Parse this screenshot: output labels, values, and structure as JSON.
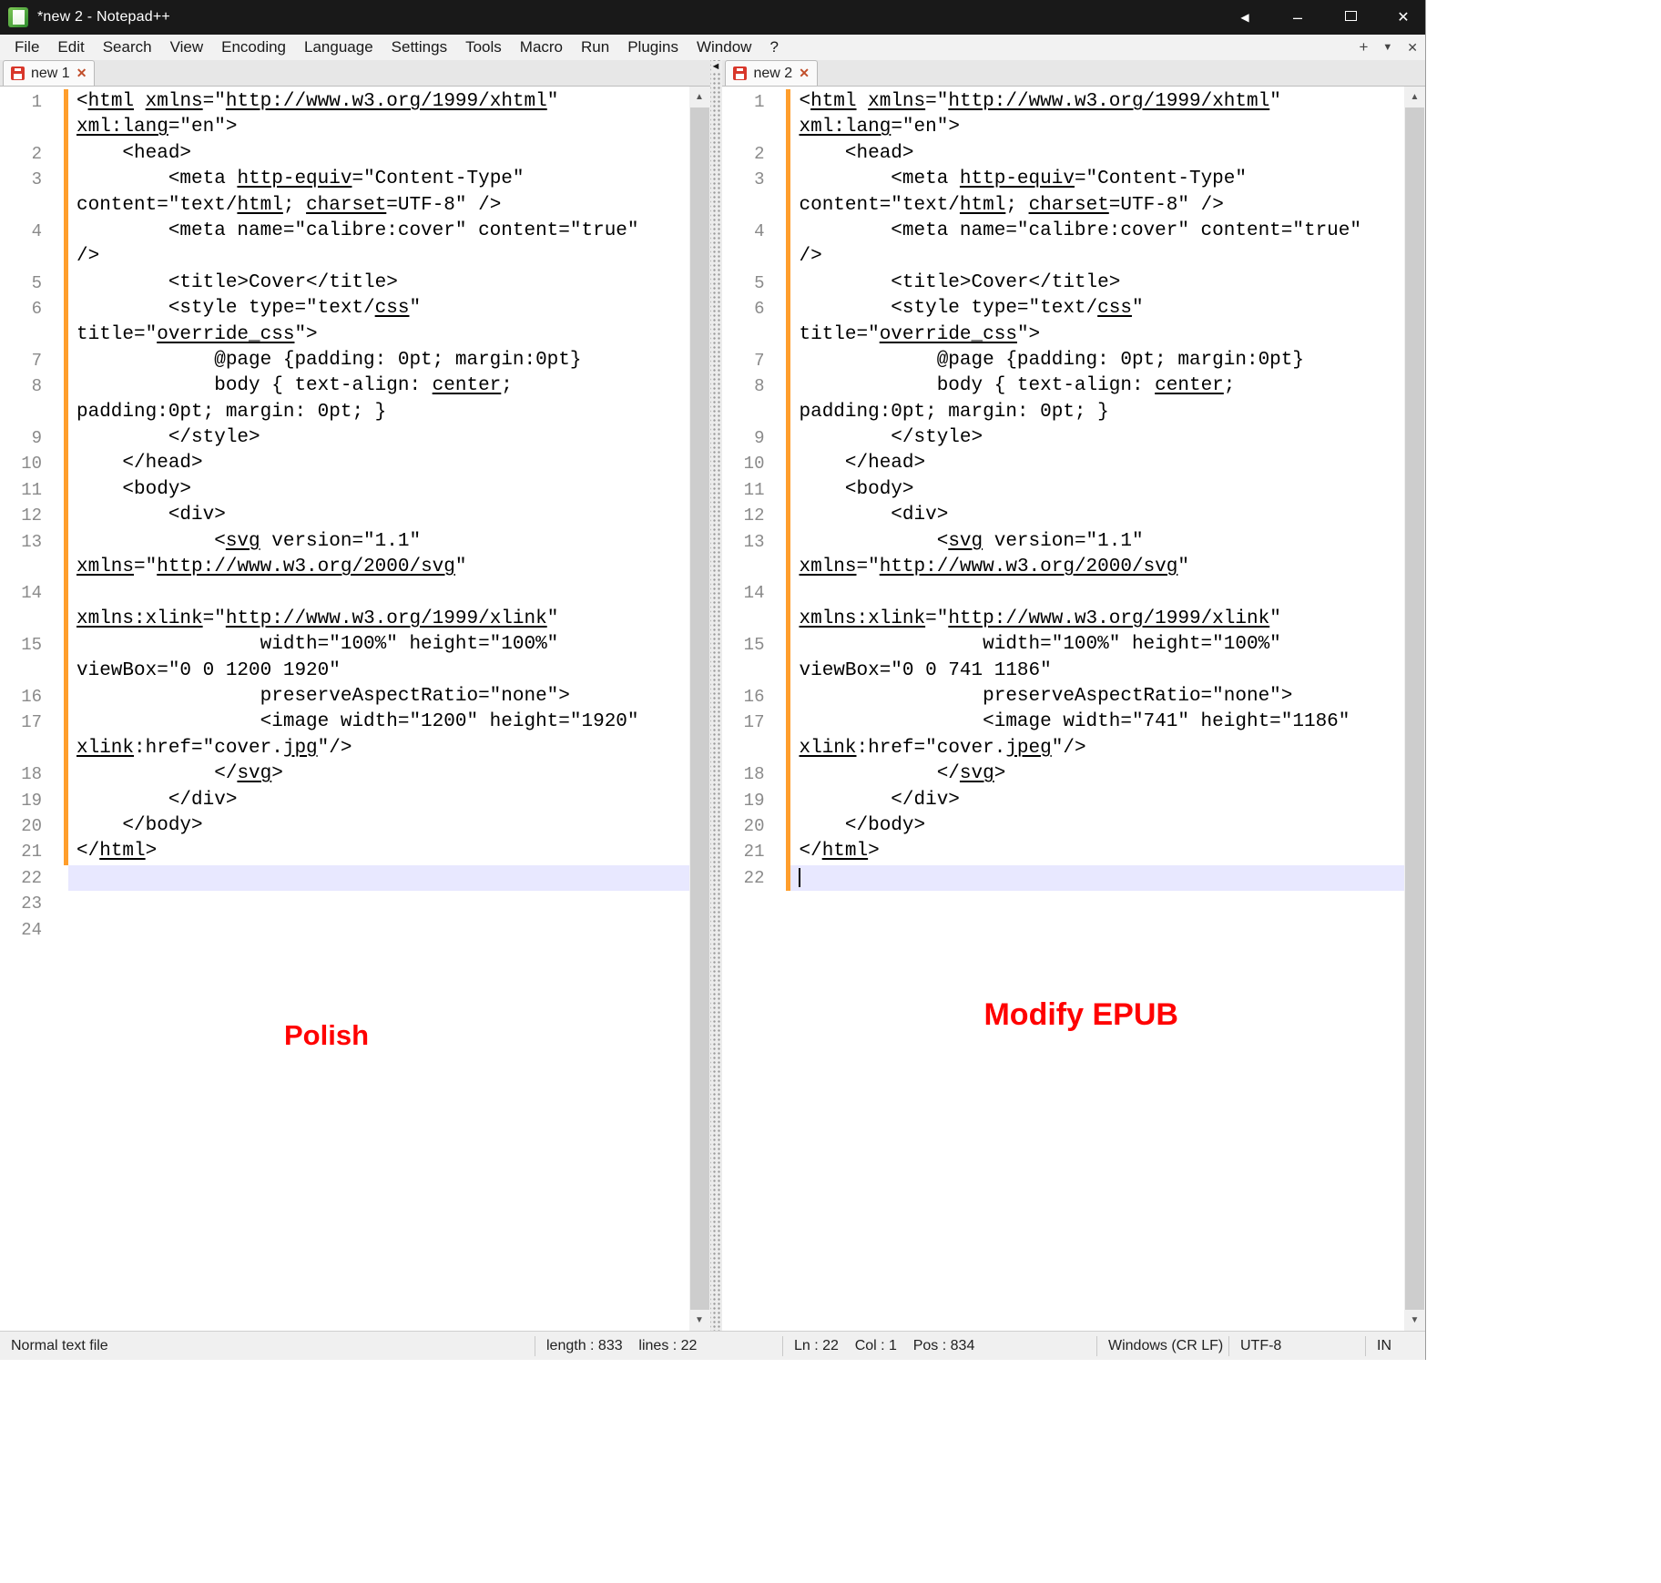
{
  "window": {
    "title": "*new 2 - Notepad++"
  },
  "menu": {
    "items": [
      "File",
      "Edit",
      "Search",
      "View",
      "Encoding",
      "Language",
      "Settings",
      "Tools",
      "Macro",
      "Run",
      "Plugins",
      "Window",
      "?"
    ]
  },
  "panes": [
    {
      "tab_label": "new 1",
      "annotation": "Polish",
      "highlight_row": 30,
      "caret_row": -1,
      "modified_last_row": 29,
      "rows": [
        {
          "n": "1",
          "t": "<⟦html⟧ ⟦xmlns⟧=\"⟦http://www.w3.org/1999/xhtml⟧\""
        },
        {
          "n": "",
          "t": "⟦xml:lang⟧=\"en\">"
        },
        {
          "n": "2",
          "t": "    <head>"
        },
        {
          "n": "3",
          "t": "        <meta ⟦http-equiv⟧=\"Content-Type\""
        },
        {
          "n": "",
          "t": "content=\"text/⟦html⟧; ⟦charset⟧=UTF-8\" />"
        },
        {
          "n": "4",
          "t": "        <meta name=\"calibre:cover\" content=\"true\""
        },
        {
          "n": "",
          "t": "/>"
        },
        {
          "n": "5",
          "t": "        <title>Cover</title>"
        },
        {
          "n": "6",
          "t": "        <style type=\"text/⟦css⟧\""
        },
        {
          "n": "",
          "t": "title=\"⟦override_css⟧\">"
        },
        {
          "n": "7",
          "t": "            @page {padding: 0pt; margin:0pt}"
        },
        {
          "n": "8",
          "t": "            body { text-align: ⟦center⟧;"
        },
        {
          "n": "",
          "t": "padding:0pt; margin: 0pt; }"
        },
        {
          "n": "9",
          "t": "        </style>"
        },
        {
          "n": "10",
          "t": "    </head>"
        },
        {
          "n": "11",
          "t": "    <body>"
        },
        {
          "n": "12",
          "t": "        <div>"
        },
        {
          "n": "13",
          "t": "            <⟦svg⟧ version=\"1.1\""
        },
        {
          "n": "",
          "t": "⟦xmlns⟧=\"⟦http://www.w3.org/2000/svg⟧\""
        },
        {
          "n": "14",
          "t": ""
        },
        {
          "n": "",
          "t": "⟦xmlns:xlink⟧=\"⟦http://www.w3.org/1999/xlink⟧\""
        },
        {
          "n": "15",
          "t": "                width=\"100%\" height=\"100%\""
        },
        {
          "n": "",
          "t": "viewBox=\"0 0 1200 1920\""
        },
        {
          "n": "16",
          "t": "                preserveAspectRatio=\"none\">"
        },
        {
          "n": "17",
          "t": "                <image width=\"1200\" height=\"1920\""
        },
        {
          "n": "",
          "t": "⟦xlink⟧:href=\"cover.⟦jpg⟧\"/>"
        },
        {
          "n": "18",
          "t": "            </⟦svg⟧>"
        },
        {
          "n": "19",
          "t": "        </div>"
        },
        {
          "n": "20",
          "t": "    </body>"
        },
        {
          "n": "21",
          "t": "</⟦html⟧>"
        },
        {
          "n": "22",
          "t": ""
        },
        {
          "n": "23",
          "t": ""
        },
        {
          "n": "24",
          "t": ""
        }
      ]
    },
    {
      "tab_label": "new 2",
      "annotation": "Modify EPUB",
      "highlight_row": 30,
      "caret_row": 30,
      "modified_last_row": 30,
      "rows": [
        {
          "n": "1",
          "t": "<⟦html⟧ ⟦xmlns⟧=\"⟦http://www.w3.org/1999/xhtml⟧\""
        },
        {
          "n": "",
          "t": "⟦xml:lang⟧=\"en\">"
        },
        {
          "n": "2",
          "t": "    <head>"
        },
        {
          "n": "3",
          "t": "        <meta ⟦http-equiv⟧=\"Content-Type\""
        },
        {
          "n": "",
          "t": "content=\"text/⟦html⟧; ⟦charset⟧=UTF-8\" />"
        },
        {
          "n": "4",
          "t": "        <meta name=\"calibre:cover\" content=\"true\""
        },
        {
          "n": "",
          "t": "/>"
        },
        {
          "n": "5",
          "t": "        <title>Cover</title>"
        },
        {
          "n": "6",
          "t": "        <style type=\"text/⟦css⟧\""
        },
        {
          "n": "",
          "t": "title=\"⟦override_css⟧\">"
        },
        {
          "n": "7",
          "t": "            @page {padding: 0pt; margin:0pt}"
        },
        {
          "n": "8",
          "t": "            body { text-align: ⟦center⟧;"
        },
        {
          "n": "",
          "t": "padding:0pt; margin: 0pt; }"
        },
        {
          "n": "9",
          "t": "        </style>"
        },
        {
          "n": "10",
          "t": "    </head>"
        },
        {
          "n": "11",
          "t": "    <body>"
        },
        {
          "n": "12",
          "t": "        <div>"
        },
        {
          "n": "13",
          "t": "            <⟦svg⟧ version=\"1.1\""
        },
        {
          "n": "",
          "t": "⟦xmlns⟧=\"⟦http://www.w3.org/2000/svg⟧\""
        },
        {
          "n": "14",
          "t": ""
        },
        {
          "n": "",
          "t": "⟦xmlns:xlink⟧=\"⟦http://www.w3.org/1999/xlink⟧\""
        },
        {
          "n": "15",
          "t": "                width=\"100%\" height=\"100%\""
        },
        {
          "n": "",
          "t": "viewBox=\"0 0 741 1186\""
        },
        {
          "n": "16",
          "t": "                preserveAspectRatio=\"none\">"
        },
        {
          "n": "17",
          "t": "                <image width=\"741\" height=\"1186\""
        },
        {
          "n": "",
          "t": "⟦xlink⟧:href=\"cover.⟦jpeg⟧\"/>"
        },
        {
          "n": "18",
          "t": "            </⟦svg⟧>"
        },
        {
          "n": "19",
          "t": "        </div>"
        },
        {
          "n": "20",
          "t": "    </body>"
        },
        {
          "n": "21",
          "t": "</⟦html⟧>"
        },
        {
          "n": "22",
          "t": ""
        }
      ]
    }
  ],
  "status": {
    "doc_type": "Normal text file",
    "length_lines": "length : 833    lines : 22",
    "position": "Ln : 22    Col : 1    Pos : 834",
    "eol": "Windows (CR LF)",
    "encoding": "UTF-8",
    "typing_mode": "IN"
  }
}
